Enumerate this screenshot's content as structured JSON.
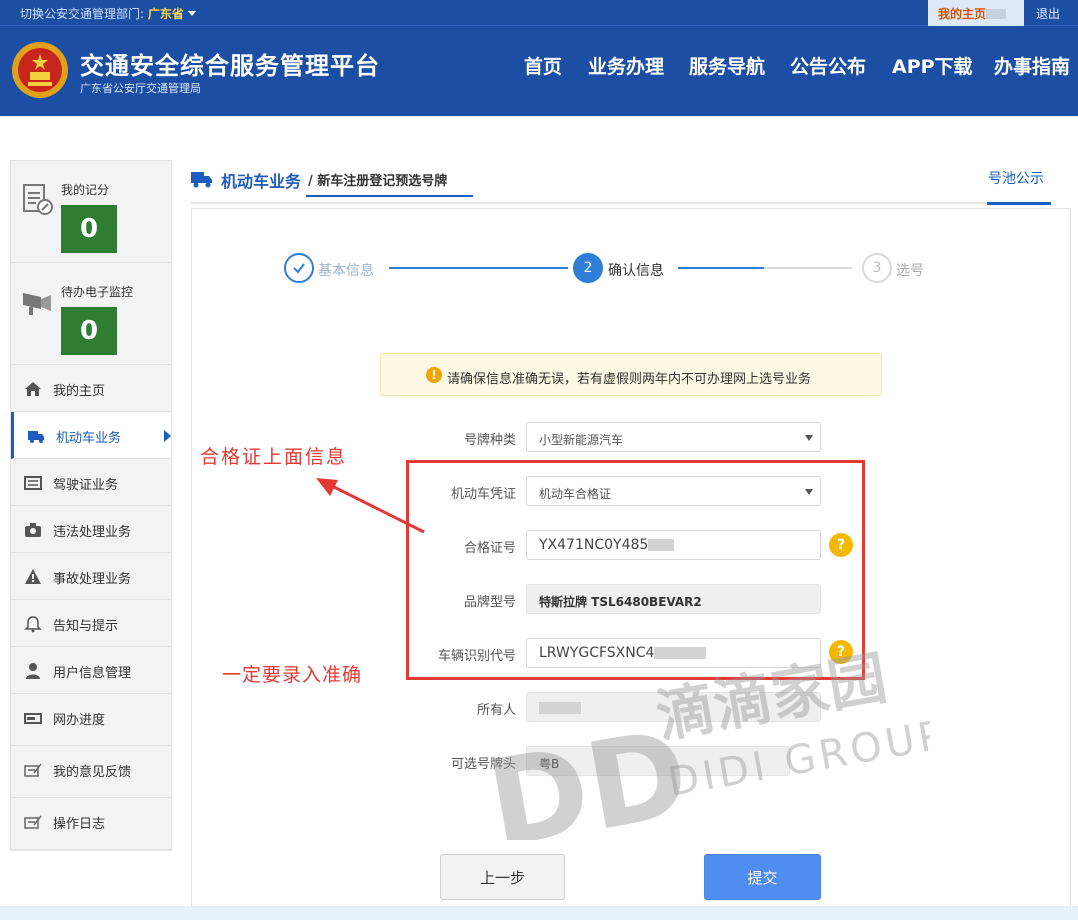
{
  "topbar": {
    "switch_label": "切换公安交通管理部门:",
    "province": "广东省",
    "home_label": "我的主页",
    "logout_label": "退出"
  },
  "header": {
    "title": "交通安全综合服务管理平台",
    "subtitle": "广东省公安厅交通管理局",
    "nav": [
      "首页",
      "业务办理",
      "服务导航",
      "公告公布",
      "APP下载",
      "办事指南"
    ]
  },
  "sidebar": {
    "scores": [
      {
        "label": "我的记分",
        "value": "0",
        "icon": "document-edit-icon"
      },
      {
        "label": "待办电子监控",
        "value": "0",
        "icon": "camera-icon"
      }
    ],
    "items": [
      {
        "label": "我的主页",
        "icon": "home-icon"
      },
      {
        "label": "机动车业务",
        "icon": "truck-icon"
      },
      {
        "label": "驾驶证业务",
        "icon": "license-card-icon"
      },
      {
        "label": "违法处理业务",
        "icon": "camera-icon"
      },
      {
        "label": "事故处理业务",
        "icon": "warning-icon"
      },
      {
        "label": "告知与提示",
        "icon": "bell-icon"
      },
      {
        "label": "用户信息管理",
        "icon": "user-icon"
      },
      {
        "label": "网办进度",
        "icon": "progress-icon"
      },
      {
        "label": "我的意见反馈",
        "icon": "feedback-icon"
      },
      {
        "label": "操作日志",
        "icon": "log-icon"
      }
    ]
  },
  "breadcrumb": {
    "section": "机动车业务",
    "separator": "/",
    "page": "新车注册登记预选号牌",
    "pool_link": "号池公示"
  },
  "steps": [
    {
      "number": "1",
      "label": "基本信息",
      "state": "done"
    },
    {
      "number": "2",
      "label": "确认信息",
      "state": "active"
    },
    {
      "number": "3",
      "label": "选号",
      "state": "pending"
    }
  ],
  "notice": {
    "icon": "!",
    "text": "请确保信息准确无误，若有虚假则两年内不可办理网上选号业务"
  },
  "form": {
    "plate_type": {
      "label": "号牌种类",
      "value": "小型新能源汽车"
    },
    "certificate": {
      "label": "机动车凭证",
      "value": "机动车合格证"
    },
    "cert_no": {
      "label": "合格证号",
      "value": "YX471NC0Y485"
    },
    "brand": {
      "label": "品牌型号",
      "value": "特斯拉牌 TSL6480BEVAR2"
    },
    "vin": {
      "label": "车辆识别代号",
      "value": "LRWYGCFSXNC4"
    },
    "owner": {
      "label": "所有人",
      "value": ""
    },
    "plate_prefix": {
      "label": "可选号牌头",
      "value": "粤B"
    }
  },
  "annotations": {
    "cert_info": "合格证上面信息",
    "must_accurate": "一定要录入准确"
  },
  "buttons": {
    "prev": "上一步",
    "submit": "提交"
  },
  "watermark": {
    "logo": "DD",
    "cn": "滴滴家园",
    "en": "DIDI GROUP"
  },
  "colors": {
    "brand_blue": "#1c4ea3",
    "link_blue": "#1e5dbf",
    "score_green": "#2f7d32",
    "annotation_red": "#e53935",
    "submit_blue": "#4f8ef0"
  }
}
